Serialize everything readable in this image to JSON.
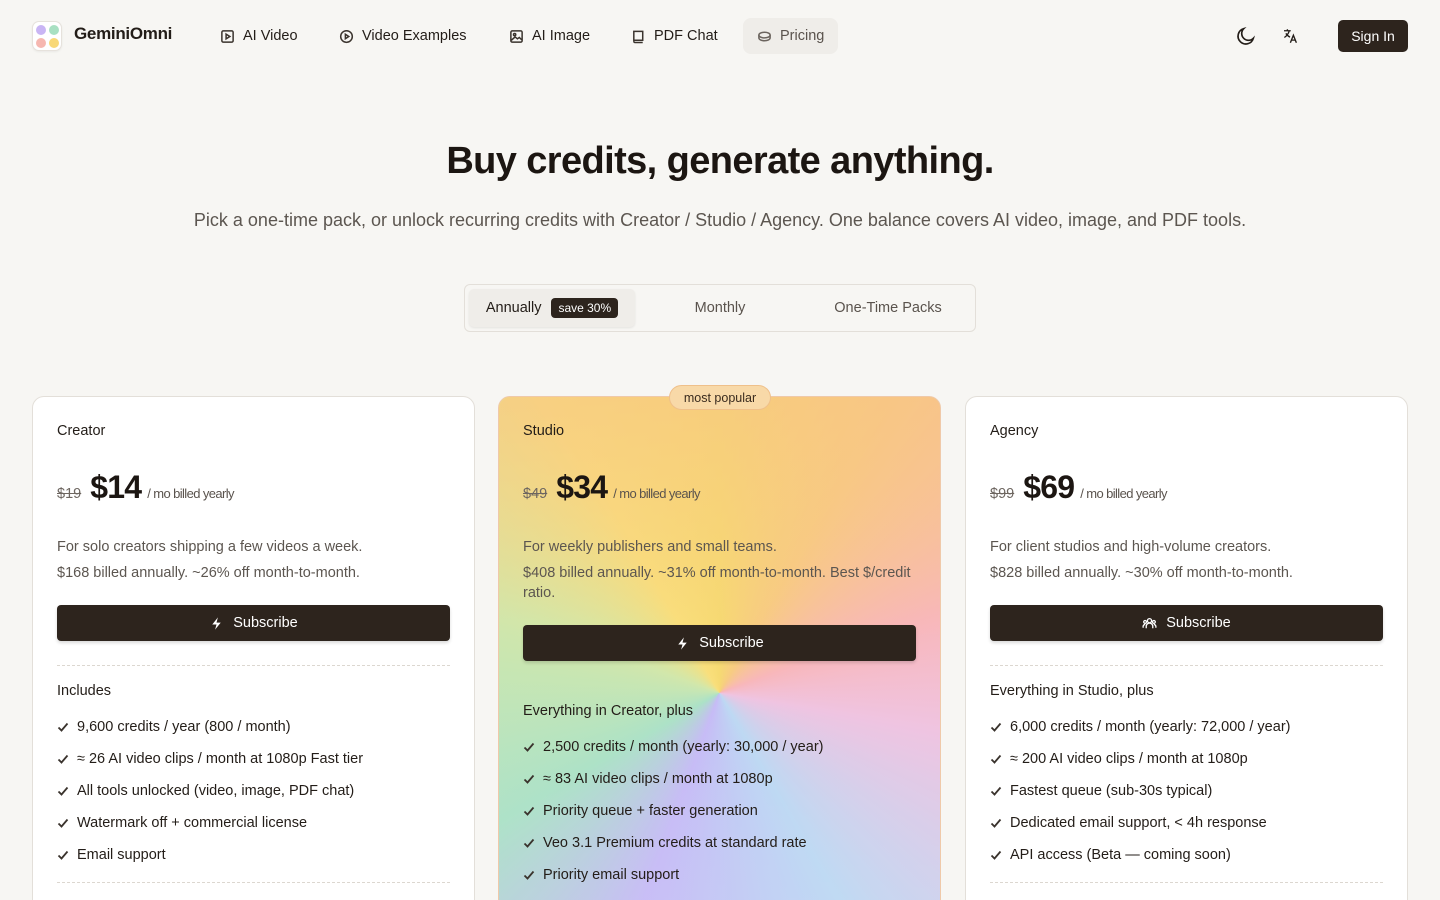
{
  "brand": {
    "name": "GeminiOmni"
  },
  "nav": [
    {
      "label": "AI Video",
      "icon": "video-square-icon"
    },
    {
      "label": "Video Examples",
      "icon": "play-circle-icon"
    },
    {
      "label": "AI Image",
      "icon": "image-icon"
    },
    {
      "label": "PDF Chat",
      "icon": "book-icon"
    },
    {
      "label": "Pricing",
      "icon": "coins-icon",
      "active": true
    }
  ],
  "header": {
    "theme_icon": "moon-icon",
    "language_icon": "translate-icon",
    "sign_in": "Sign In"
  },
  "hero": {
    "title": "Buy credits, generate anything.",
    "subtitle": "Pick a one-time pack, or unlock recurring credits with Creator / Studio / Agency. One balance covers AI video, image, and PDF tools."
  },
  "billing_toggle": {
    "options": [
      "Annually",
      "Monthly",
      "One-Time Packs"
    ],
    "selected": "Annually",
    "badge": "save 30%"
  },
  "plans": [
    {
      "name": "Creator",
      "old_price": "$19",
      "price": "$14",
      "per": "/ mo billed yearly",
      "description": "For solo creators shipping a few videos a week.",
      "billing": "$168 billed annually. ~26% off month-to-month.",
      "button": "Subscribe",
      "button_icon": "bolt-icon",
      "includes_title": "Includes",
      "features": [
        "9,600 credits / year (800 / month)",
        "≈ 26 AI video clips / month at 1080p Fast tier",
        "All tools unlocked (video, image, PDF chat)",
        "Watermark off + commercial license",
        "Email support"
      ]
    },
    {
      "name": "Studio",
      "badge": "most popular",
      "old_price": "$49",
      "price": "$34",
      "per": "/ mo billed yearly",
      "description": "For weekly publishers and small teams.",
      "billing": "$408 billed annually. ~31% off month-to-month. Best $/credit ratio.",
      "button": "Subscribe",
      "button_icon": "bolt-icon",
      "includes_title": "Everything in Creator, plus",
      "features": [
        "2,500 credits / month (yearly: 30,000 / year)",
        "≈ 83 AI video clips / month at 1080p",
        "Priority queue + faster generation",
        "Veo 3.1 Premium credits at standard rate",
        "Priority email support"
      ]
    },
    {
      "name": "Agency",
      "old_price": "$99",
      "price": "$69",
      "per": "/ mo billed yearly",
      "description": "For client studios and high-volume creators.",
      "billing": "$828 billed annually. ~30% off month-to-month.",
      "button": "Subscribe",
      "button_icon": "users-icon",
      "includes_title": "Everything in Studio, plus",
      "features": [
        "6,000 credits / month (yearly: 72,000 / year)",
        "≈ 200 AI video clips / month at 1080p",
        "Fastest queue (sub-30s typical)",
        "Dedicated email support, < 4h response",
        "API access (Beta — coming soon)"
      ]
    }
  ],
  "colors": {
    "primary": "#2d241d",
    "background": "#f7f6f3",
    "muted_text": "#5c5650"
  }
}
